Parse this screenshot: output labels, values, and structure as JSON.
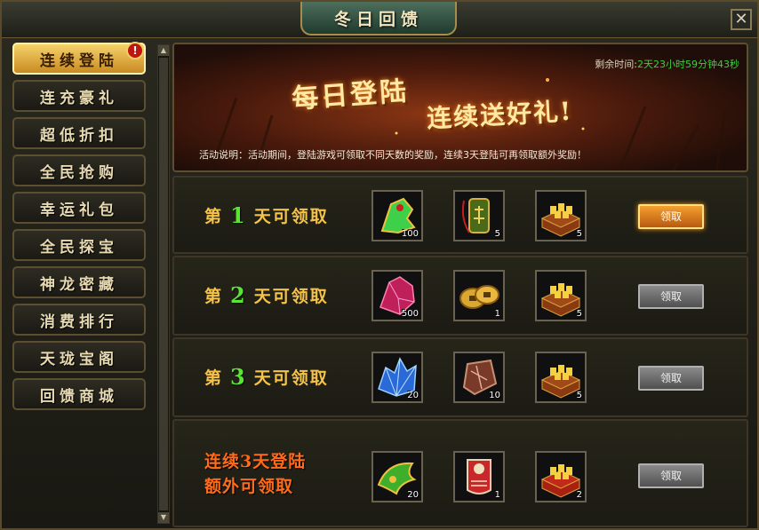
{
  "window": {
    "title": "冬日回馈",
    "close_label": "✕"
  },
  "sidebar": {
    "badge": "!",
    "items": [
      {
        "label": "连续登陆",
        "active": true
      },
      {
        "label": "连充豪礼"
      },
      {
        "label": "超低折扣"
      },
      {
        "label": "全民抢购"
      },
      {
        "label": "幸运礼包"
      },
      {
        "label": "全民探宝"
      },
      {
        "label": "神龙密藏"
      },
      {
        "label": "消费排行"
      },
      {
        "label": "天珑宝阁"
      },
      {
        "label": "回馈商城"
      }
    ]
  },
  "banner": {
    "title1": "每日登陆",
    "title2": "连续送好礼!",
    "timer_label": "剩余时间:",
    "timer_value": "2天23小时59分钟43秒",
    "description": "活动说明：活动期间，登陆游戏可领取不同天数的奖励，连续3天登陆可再领取额外奖励！"
  },
  "rows": [
    {
      "prefix": "第",
      "day": "1",
      "suffix": "天可领取",
      "items": [
        {
          "icon": "jade-mount-icon",
          "count": "100"
        },
        {
          "icon": "talisman-icon",
          "count": "5"
        },
        {
          "icon": "gold-chest-icon",
          "count": "5"
        }
      ],
      "claim_label": "领取",
      "claim_active": true
    },
    {
      "prefix": "第",
      "day": "2",
      "suffix": "天可领取",
      "items": [
        {
          "icon": "red-crystal-icon",
          "count": "500"
        },
        {
          "icon": "gold-coin-icon",
          "count": "1"
        },
        {
          "icon": "gold-chest-icon",
          "count": "5"
        }
      ],
      "claim_label": "领取",
      "claim_active": false
    },
    {
      "prefix": "第",
      "day": "3",
      "suffix": "天可领取",
      "items": [
        {
          "icon": "blue-crystal-icon",
          "count": "20"
        },
        {
          "icon": "brown-stone-icon",
          "count": "10"
        },
        {
          "icon": "gold-chest-icon",
          "count": "5"
        }
      ],
      "claim_label": "领取",
      "claim_active": false
    }
  ],
  "bonus_row": {
    "line1": "连续3天登陆",
    "line2": "额外可领取",
    "items": [
      {
        "icon": "jade-wing-icon",
        "count": "20"
      },
      {
        "icon": "scroll-icon",
        "count": "1"
      },
      {
        "icon": "gold-chest-icon",
        "count": "2"
      }
    ],
    "claim_label": "领取"
  },
  "colors": {
    "accent_gold": "#f5c24a",
    "day_green": "#58e632",
    "timer_green": "#36d43a",
    "bonus_orange": "#ff6b1a"
  }
}
